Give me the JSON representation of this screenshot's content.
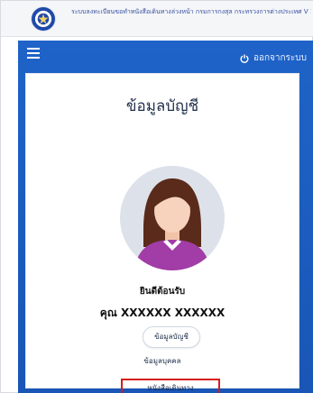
{
  "banner": {
    "title": "ระบบลงทะเบียนขอทำหนังสือเดินทางล่วงหน้า กรมการกงสุล กระทรวงการต่างประเทศ V 1.3.5"
  },
  "header": {
    "menu_icon": "hamburger-icon",
    "logout_icon": "power-icon",
    "logout_label": "ออกจากระบบ"
  },
  "profile": {
    "title": "ข้อมูลบัญชี",
    "avatar_icon": "user-avatar-female",
    "welcome": "ยินดีต้อนรับ",
    "name": "คุณ XXXXXX XXXXXX"
  },
  "nav": {
    "account_label": "ข้อมูลบัญชี",
    "personal_label": "ข้อมูลบุคคล",
    "passport_label": "หนังสือเดินทาง",
    "highlight_color": "#d61b1b"
  },
  "colors": {
    "primary": "#1f63c8",
    "banner_text": "#3a4fa0"
  }
}
